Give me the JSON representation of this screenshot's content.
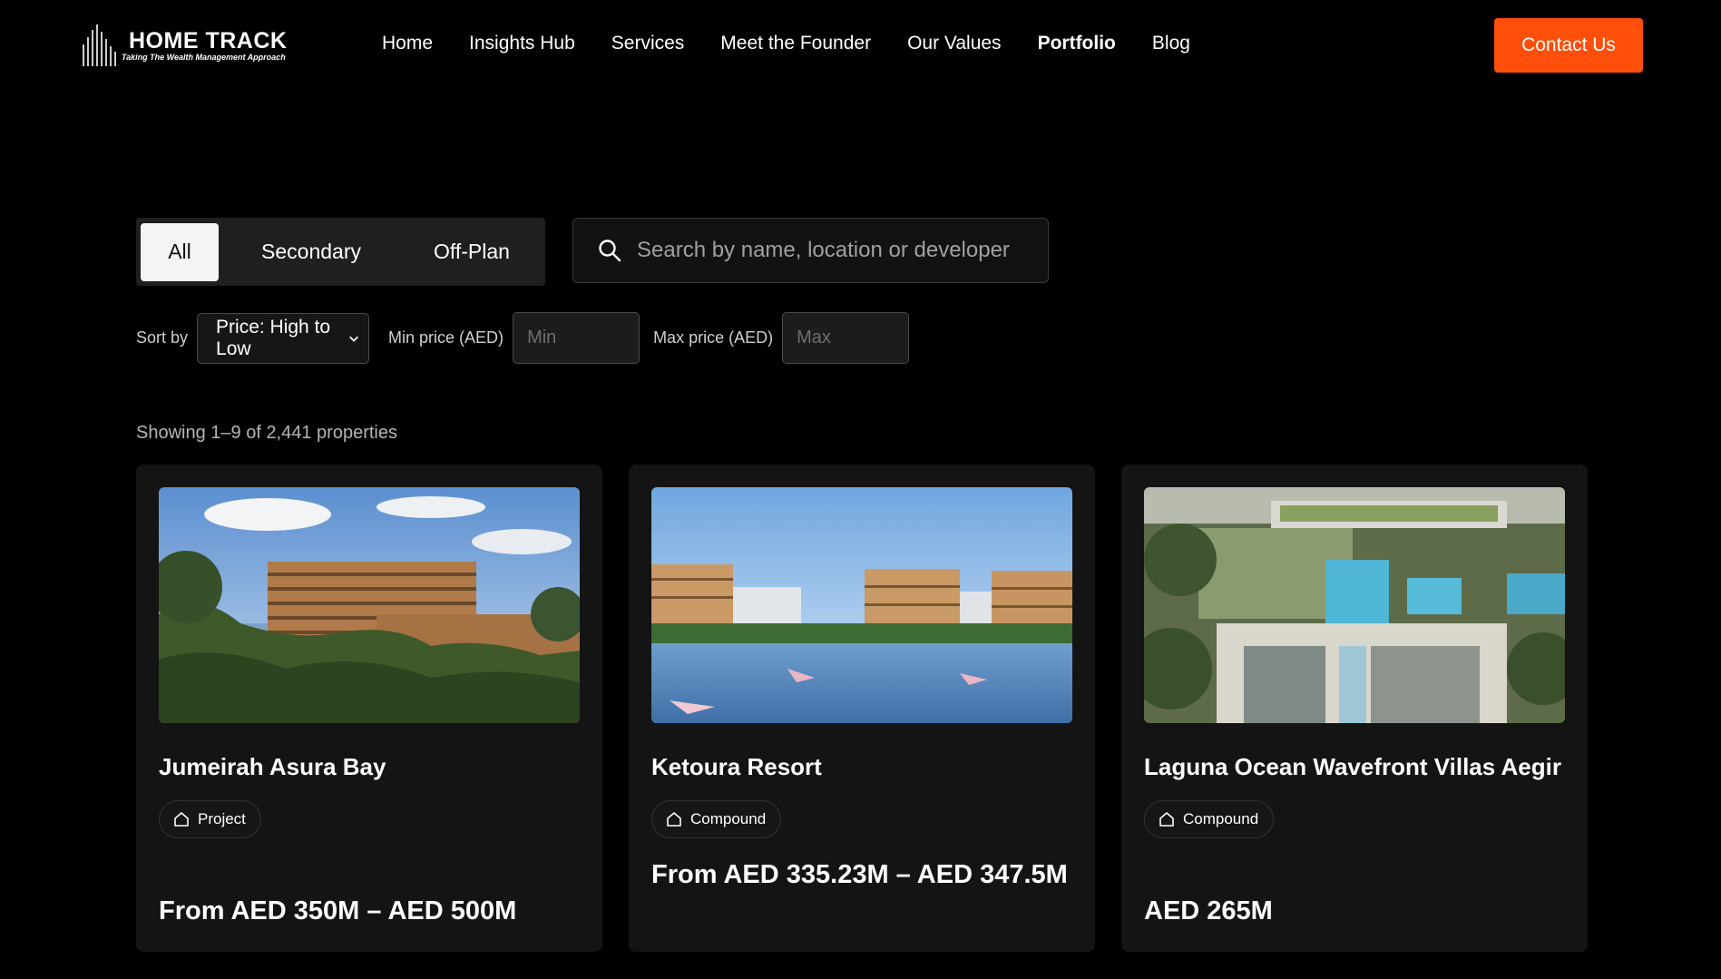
{
  "brand": {
    "title": "HOME TRACK",
    "tagline": "Taking The Wealth Management Approach"
  },
  "nav": {
    "items": [
      {
        "label": "Home",
        "active": false
      },
      {
        "label": "Insights Hub",
        "active": false
      },
      {
        "label": "Services",
        "active": false
      },
      {
        "label": "Meet the Founder",
        "active": false
      },
      {
        "label": "Our Values",
        "active": false
      },
      {
        "label": "Portfolio",
        "active": true
      },
      {
        "label": "Blog",
        "active": false
      }
    ],
    "contact_label": "Contact Us"
  },
  "filters": {
    "tabs": [
      "All",
      "Secondary",
      "Off-Plan"
    ],
    "selected_tab": "All",
    "search_placeholder": "Search by name, location or developer",
    "sort_label": "Sort by",
    "sort_value": "Price: High to Low",
    "min_label": "Min price (AED)",
    "min_placeholder": "Min",
    "max_label": "Max price (AED)",
    "max_placeholder": "Max"
  },
  "results": {
    "showing": "Showing 1–9 of 2,441 properties"
  },
  "cards": [
    {
      "title": "Jumeirah Asura Bay",
      "type": "Project",
      "price": "From AED 350M – AED 500M"
    },
    {
      "title": "Ketoura Resort",
      "type": "Compound",
      "price": "From AED 335.23M – AED 347.5M"
    },
    {
      "title": "Laguna Ocean Wavefront Villas Aegir",
      "type": "Compound",
      "price": "AED 265M"
    }
  ],
  "colors": {
    "accent": "#ff4f0a",
    "background": "#000000",
    "card": "#141414"
  },
  "icons": [
    "logo-mark-icon",
    "search-icon",
    "chevron-down-icon",
    "home-icon"
  ]
}
